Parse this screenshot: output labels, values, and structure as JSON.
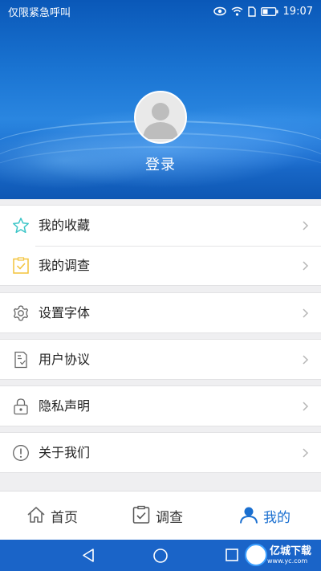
{
  "status_bar": {
    "left_text": "仅限紧急呼叫",
    "time": "19:07",
    "icons": [
      "eye-icon",
      "wifi-icon",
      "sim-icon",
      "battery-icon"
    ]
  },
  "profile": {
    "login_label": "登录",
    "avatar_icon": "default-avatar-icon"
  },
  "menu_groups": [
    [
      {
        "icon": "star-icon",
        "label": "我的收藏"
      },
      {
        "icon": "survey-check-icon",
        "label": "我的调查"
      }
    ],
    [
      {
        "icon": "gear-icon",
        "label": "设置字体"
      }
    ],
    [
      {
        "icon": "document-icon",
        "label": "用户协议"
      }
    ],
    [
      {
        "icon": "lock-icon",
        "label": "隐私声明"
      }
    ],
    [
      {
        "icon": "info-icon",
        "label": "关于我们"
      }
    ]
  ],
  "bottom_nav": {
    "tabs": [
      {
        "icon": "home-icon",
        "label": "首页",
        "active": false
      },
      {
        "icon": "survey-icon",
        "label": "调查",
        "active": false
      },
      {
        "icon": "user-icon",
        "label": "我的",
        "active": true
      }
    ]
  },
  "system_nav": {
    "icons": [
      "back-icon",
      "home-circle-icon",
      "recents-icon"
    ]
  },
  "watermark": {
    "title": "亿城下载",
    "subtitle": "www.yc.com"
  },
  "colors": {
    "accent": "#1a6fd0",
    "star": "#3ec6c8",
    "survey": "#f3c33b",
    "icon_gray": "#666666",
    "chevron": "#b5b5b5"
  }
}
